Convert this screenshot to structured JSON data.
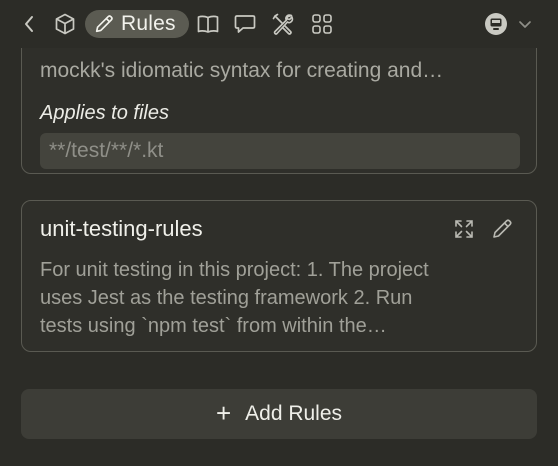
{
  "toolbar": {
    "back_icon": "chevron-left-icon",
    "tabs": [
      {
        "name": "cube-icon"
      },
      {
        "name": "pencil-icon",
        "label": "Rules",
        "active": true
      },
      {
        "name": "book-icon"
      },
      {
        "name": "chat-bubble-icon"
      },
      {
        "name": "tools-icon"
      },
      {
        "name": "grid-icon"
      }
    ],
    "model_icon": "model-icon",
    "dropdown_icon": "chevron-down-icon"
  },
  "rules": [
    {
      "description_visible": "mockk's idiomatic syntax for creating and…",
      "applies_label": "Applies to files",
      "glob": "**/test/**/*.kt"
    },
    {
      "name": "unit-testing-rules",
      "description_lines": [
        "For unit testing in this project: 1. The project",
        "uses Jest as the testing framework 2. Run",
        "tests using `npm test` from within the…"
      ]
    }
  ],
  "add_button": {
    "icon": "+",
    "label": "Add Rules"
  },
  "colors": {
    "background": "#2c2c27",
    "card_border": "#5a5a52",
    "active_tab": "#5b5b52",
    "button_bg": "#3d3d37",
    "input_bg": "#44443d"
  }
}
